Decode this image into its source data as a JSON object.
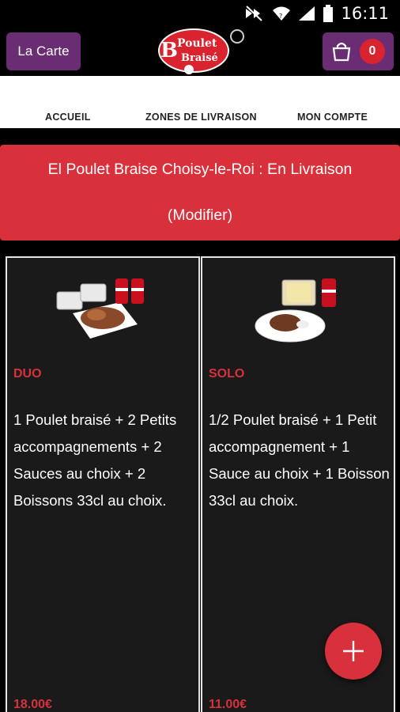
{
  "status_bar": {
    "time": "16:11",
    "icons": [
      "mute-icon",
      "wifi-icon",
      "signal-icon",
      "battery-icon"
    ]
  },
  "app_bar": {
    "menu_label": "La Carte",
    "cart_count": "0",
    "logo": {
      "line1": "Poulet",
      "line2": "Braisé",
      "letter": "B"
    }
  },
  "tabs": [
    {
      "label": "ACCUEIL"
    },
    {
      "label": "ZONES DE LIVRAISON"
    },
    {
      "label": "MON COMPTE"
    }
  ],
  "banner": {
    "title": "El Poulet Braise Choisy-le-Roi : En Livraison",
    "modify_label": "(Modifier)"
  },
  "products": [
    {
      "name": "DUO",
      "description": "1 Poulet braisé + 2 Petits accompagnements + 2 Sauces au choix + 2 Boissons 33cl au choix.",
      "price": "18.00€"
    },
    {
      "name": "SOLO",
      "description": "1/2 Poulet braisé + 1 Petit accompagnement + 1 Sauce au choix + 1 Boisson 33cl au choix.",
      "price": "11.00€"
    }
  ],
  "colors": {
    "accent_red": "#d9313b",
    "purple": "#6a2d73",
    "background": "#000000",
    "card_bg": "#1a1a1a"
  }
}
